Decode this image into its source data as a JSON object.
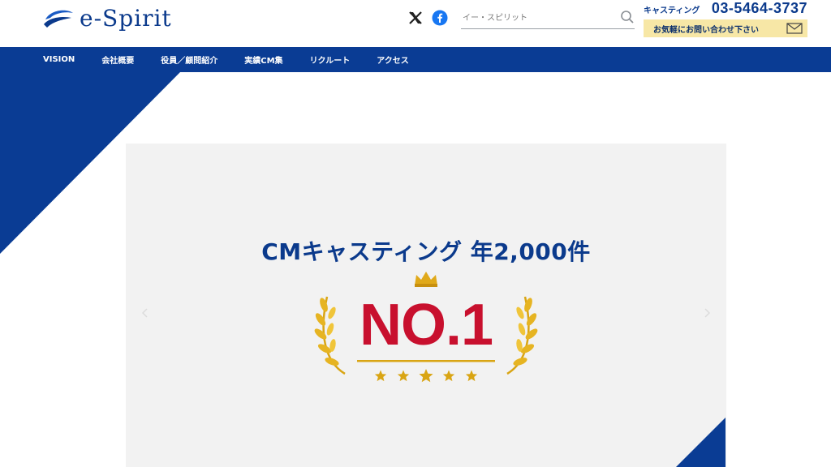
{
  "header": {
    "logo_text": "e-Spirit",
    "search_placeholder": "イー・スピリット",
    "tel_label": "キャスティング",
    "tel_number": "03-5464-3737",
    "inquiry_label": "お気軽にお問い合わせ下さい"
  },
  "nav": {
    "items": [
      "VISION",
      "会社概要",
      "役員／顧問紹介",
      "実績CM集",
      "リクルート",
      "アクセス"
    ]
  },
  "hero": {
    "headline": "CMキャスティング 年2,000件",
    "badge_text": "NO.1",
    "stars": 5
  },
  "colors": {
    "brand_blue": "#0a3c94",
    "badge_red": "#c8102e",
    "gold": "#d9a514",
    "inquiry_bg": "#f7e7a6"
  },
  "icons": [
    "x-logo-icon",
    "facebook-icon",
    "search-icon",
    "mail-icon",
    "laurel-icon",
    "crown-icon",
    "star-icon",
    "chevron-left-icon",
    "chevron-right-icon"
  ]
}
